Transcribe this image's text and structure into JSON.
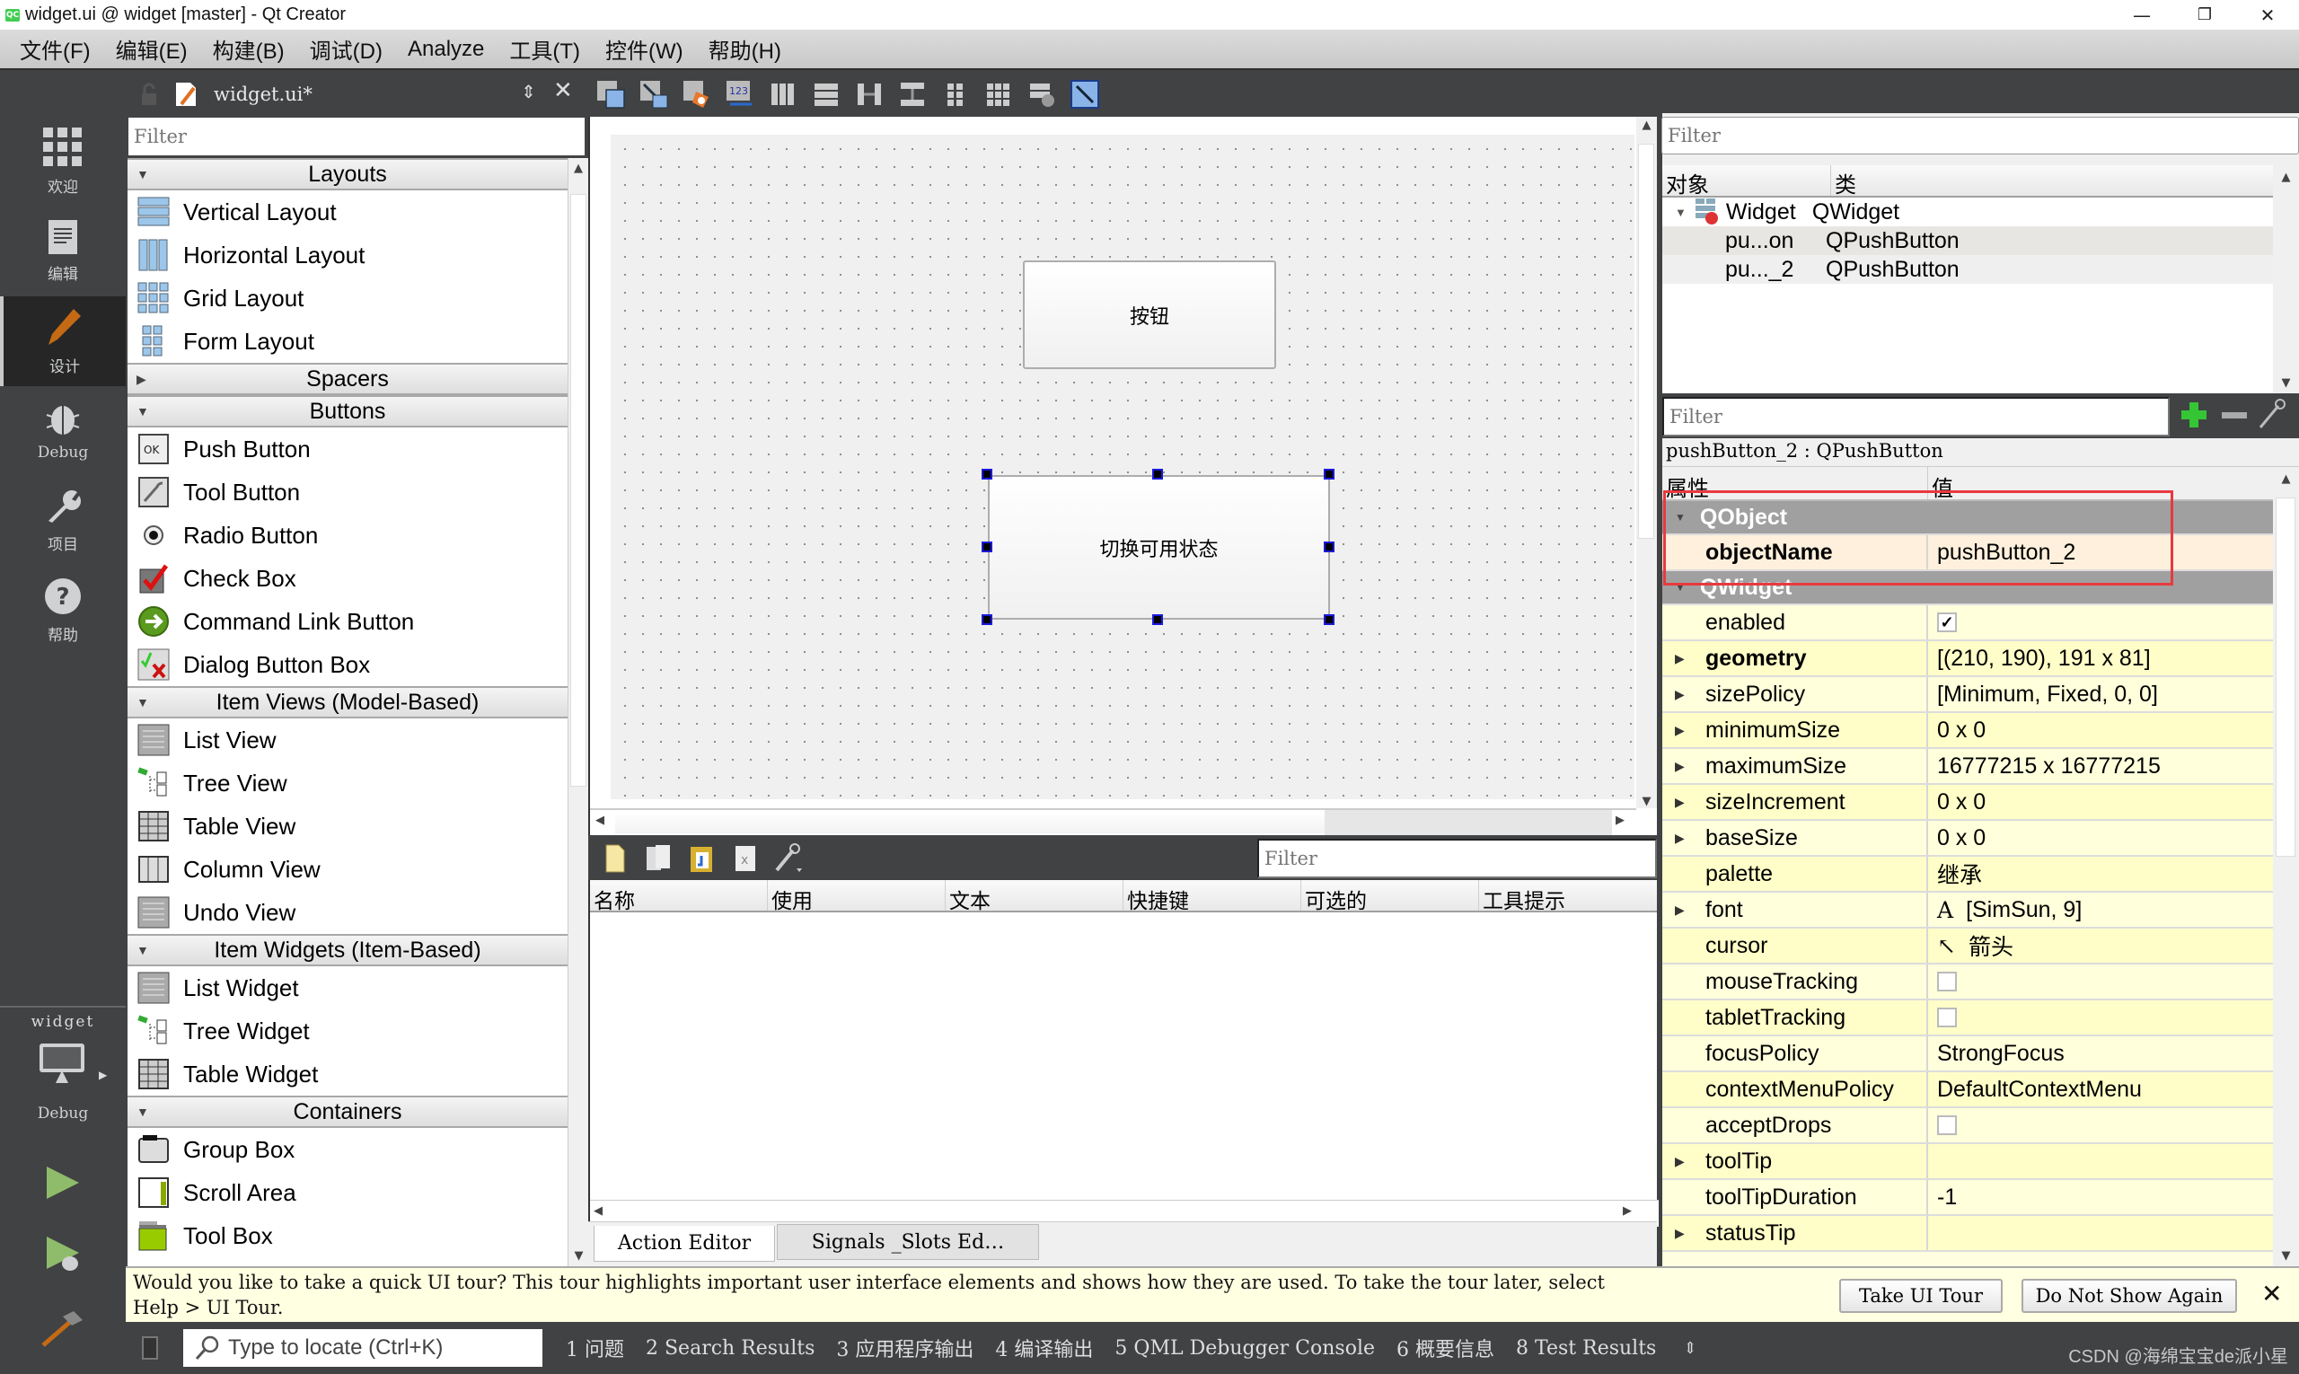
{
  "window": {
    "title": "widget.ui @ widget [master] - Qt Creator",
    "app_icon_text": "QC",
    "minimize": "—",
    "maximize": "❐",
    "close": "✕"
  },
  "menu": [
    "文件(F)",
    "编辑(E)",
    "构建(B)",
    "调试(D)",
    "Analyze",
    "工具(T)",
    "控件(W)",
    "帮助(H)"
  ],
  "modes": [
    {
      "label": "欢迎",
      "icon": "welcome-grid-icon"
    },
    {
      "label": "编辑",
      "icon": "edit-document-icon"
    },
    {
      "label": "设计",
      "icon": "design-pencil-icon",
      "active": true
    },
    {
      "label": "Debug",
      "icon": "debug-bug-icon"
    },
    {
      "label": "项目",
      "icon": "projects-wrench-icon"
    },
    {
      "label": "帮助",
      "icon": "help-question-icon"
    }
  ],
  "kit": {
    "project": "widget",
    "build": "Debug"
  },
  "document": {
    "name": "widget.ui*"
  },
  "widgetbox": {
    "filter_placeholder": "Filter",
    "categories": [
      {
        "title": "Layouts",
        "expanded": true,
        "items": [
          "Vertical Layout",
          "Horizontal Layout",
          "Grid Layout",
          "Form Layout"
        ]
      },
      {
        "title": "Spacers",
        "expanded": false,
        "items": []
      },
      {
        "title": "Buttons",
        "expanded": true,
        "items": [
          "Push Button",
          "Tool Button",
          "Radio Button",
          "Check Box",
          "Command Link Button",
          "Dialog Button Box"
        ]
      },
      {
        "title": "Item Views (Model-Based)",
        "expanded": true,
        "items": [
          "List View",
          "Tree View",
          "Table View",
          "Column View",
          "Undo View"
        ]
      },
      {
        "title": "Item Widgets (Item-Based)",
        "expanded": true,
        "items": [
          "List Widget",
          "Tree Widget",
          "Table Widget"
        ]
      },
      {
        "title": "Containers",
        "expanded": true,
        "items": [
          "Group Box",
          "Scroll Area",
          "Tool Box"
        ]
      }
    ]
  },
  "form": {
    "button1_text": "按钮",
    "button2_text": "切换可用状态"
  },
  "action_editor": {
    "filter_placeholder": "Filter",
    "columns": [
      "名称",
      "使用",
      "文本",
      "快捷键",
      "可选的",
      "工具提示"
    ],
    "tabs": [
      "Action Editor",
      "Signals _Slots Ed…"
    ]
  },
  "object_inspector": {
    "filter_placeholder": "Filter",
    "columns": [
      "对象",
      "类"
    ],
    "rows": [
      {
        "object": "Widget",
        "class": "QWidget",
        "level": 0
      },
      {
        "object": "pu...on",
        "class": "QPushButton",
        "level": 1
      },
      {
        "object": "pu..._2",
        "class": "QPushButton",
        "level": 1
      }
    ]
  },
  "property_editor": {
    "filter_placeholder": "Filter",
    "class_label": "pushButton_2 : QPushButton",
    "columns": [
      "属性",
      "值"
    ],
    "groups": [
      {
        "name": "QObject",
        "props": [
          {
            "key": "objectName",
            "value": "pushButton_2",
            "bold": true
          }
        ]
      },
      {
        "name": "QWidget",
        "props": [
          {
            "key": "enabled",
            "value": "✓",
            "type": "checkbox",
            "checked": true
          },
          {
            "key": "geometry",
            "value": "[(210, 190), 191 x 81]",
            "bold": true,
            "expandable": true
          },
          {
            "key": "sizePolicy",
            "value": "[Minimum, Fixed, 0, 0]",
            "expandable": true
          },
          {
            "key": "minimumSize",
            "value": "0 x 0",
            "expandable": true
          },
          {
            "key": "maximumSize",
            "value": "16777215 x 16777215",
            "expandable": true
          },
          {
            "key": "sizeIncrement",
            "value": "0 x 0",
            "expandable": true
          },
          {
            "key": "baseSize",
            "value": "0 x 0",
            "expandable": true
          },
          {
            "key": "palette",
            "value": "继承"
          },
          {
            "key": "font",
            "value": "[SimSun, 9]",
            "expandable": true,
            "prefix": "A"
          },
          {
            "key": "cursor",
            "value": "箭头",
            "prefix": "↖"
          },
          {
            "key": "mouseTracking",
            "value": "",
            "type": "checkbox",
            "checked": false
          },
          {
            "key": "tabletTracking",
            "value": "",
            "type": "checkbox",
            "checked": false
          },
          {
            "key": "focusPolicy",
            "value": "StrongFocus"
          },
          {
            "key": "contextMenuPolicy",
            "value": "DefaultContextMenu"
          },
          {
            "key": "acceptDrops",
            "value": "",
            "type": "checkbox",
            "checked": false
          },
          {
            "key": "toolTip",
            "value": "",
            "expandable": true
          },
          {
            "key": "toolTipDuration",
            "value": "-1"
          },
          {
            "key": "statusTip",
            "value": "",
            "expandable": true
          }
        ]
      }
    ]
  },
  "tour": {
    "message_line1": "Would you like to take a quick UI tour? This tour highlights important user interface elements and shows how they are used. To take the tour later, select",
    "message_line2": "Help > UI Tour.",
    "take_tour": "Take UI Tour",
    "dont_show": "Do Not Show Again",
    "close": "✕"
  },
  "statusbar": {
    "locator_placeholder": "Type to locate (Ctrl+K)",
    "panes": [
      "1  问题",
      "2  Search Results",
      "3  应用程序输出",
      "4  编译输出",
      "5  QML Debugger Console",
      "6  概要信息",
      "8  Test Results"
    ]
  },
  "watermark": "CSDN @海绵宝宝de派小星"
}
